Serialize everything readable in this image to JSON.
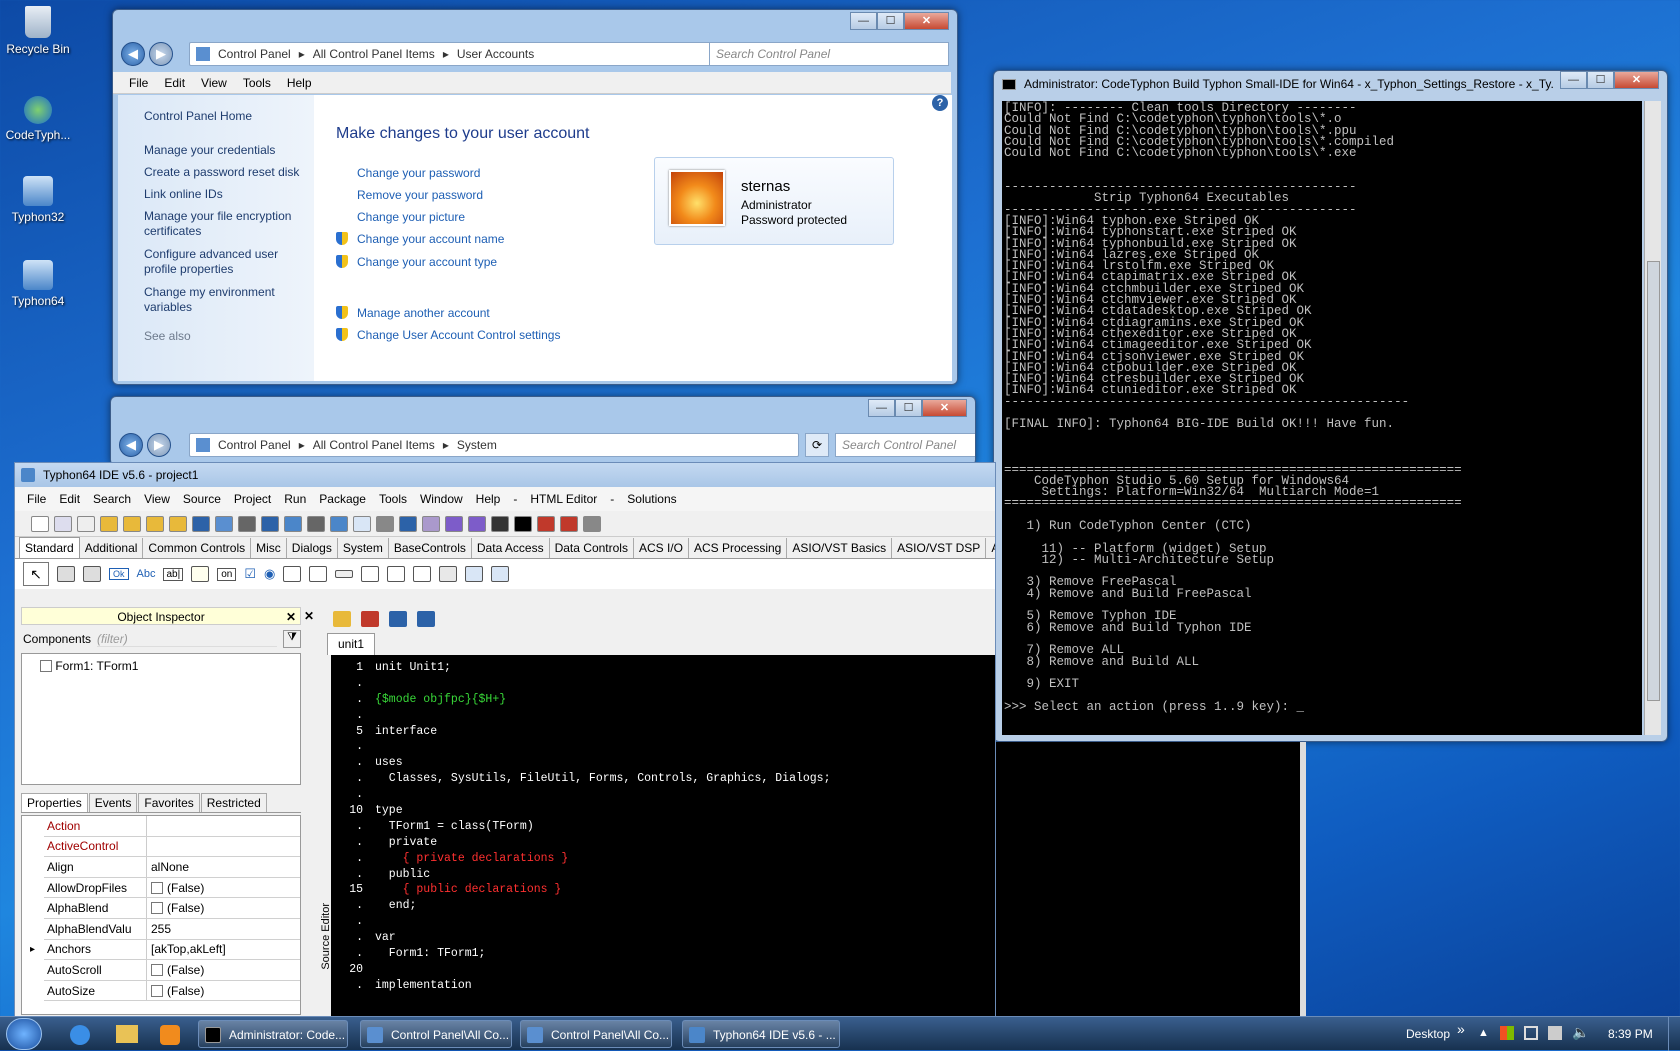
{
  "desktop": {
    "icons": [
      {
        "label": "Recycle Bin",
        "icon": "recycle-bin-icon"
      },
      {
        "label": "CodeTyph...",
        "icon": "codetyphon-icon"
      },
      {
        "label": "Typhon32",
        "icon": "typhon32-icon"
      },
      {
        "label": "Typhon64",
        "icon": "typhon64-icon"
      }
    ]
  },
  "ua_window": {
    "breadcrumb": [
      "Control Panel",
      "All Control Panel Items",
      "User Accounts"
    ],
    "search_placeholder": "Search Control Panel",
    "menu": [
      "File",
      "Edit",
      "View",
      "Tools",
      "Help"
    ],
    "side_home": "Control Panel Home",
    "side_links": [
      "Manage your credentials",
      "Create a password reset disk",
      "Link online IDs",
      "Manage your file encryption certificates",
      "Configure advanced user profile properties",
      "Change my environment variables"
    ],
    "see_also": "See also",
    "heading": "Make changes to your user account",
    "links": [
      "Change your password",
      "Remove your password",
      "Change your picture",
      "Change your account name",
      "Change your account type"
    ],
    "links2": [
      "Manage another account",
      "Change User Account Control settings"
    ],
    "user": {
      "name": "sternas",
      "role": "Administrator",
      "status": "Password protected"
    }
  },
  "sys_window": {
    "breadcrumb": [
      "Control Panel",
      "All Control Panel Items",
      "System"
    ],
    "search_placeholder": "Search Control Panel"
  },
  "console": {
    "title": "Administrator:  CodeTyphon Build Typhon Small-IDE for Win64 - x_Typhon_Settings_Restore - x_Ty...",
    "lines": [
      "[INFO]: -------- Clean tools Directory --------",
      "Could Not Find C:\\codetyphon\\typhon\\tools\\*.o",
      "Could Not Find C:\\codetyphon\\typhon\\tools\\*.ppu",
      "Could Not Find C:\\codetyphon\\typhon\\tools\\*.compiled",
      "Could Not Find C:\\codetyphon\\typhon\\tools\\*.exe",
      "",
      "",
      "-----------------------------------------------",
      "            Strip Typhon64 Executables",
      "-----------------------------------------------",
      "[INFO]:Win64 typhon.exe Striped OK",
      "[INFO]:Win64 typhonstart.exe Striped OK",
      "[INFO]:Win64 typhonbuild.exe Striped OK",
      "[INFO]:Win64 lazres.exe Striped OK",
      "[INFO]:Win64 lrstolfm.exe Striped OK",
      "[INFO]:Win64 ctapimatrix.exe Striped OK",
      "[INFO]:Win64 ctchmbuilder.exe Striped OK",
      "[INFO]:Win64 ctchmviewer.exe Striped OK",
      "[INFO]:Win64 ctdatadesktop.exe Striped OK",
      "[INFO]:Win64 ctdiagramins.exe Striped OK",
      "[INFO]:Win64 cthexeditor.exe Striped OK",
      "[INFO]:Win64 ctimageeditor.exe Striped OK",
      "[INFO]:Win64 ctjsonviewer.exe Striped OK",
      "[INFO]:Win64 ctpobuilder.exe Striped OK",
      "[INFO]:Win64 ctresbuilder.exe Striped OK",
      "[INFO]:Win64 ctunieditor.exe Striped OK",
      "------------------------------------------------------",
      "",
      "[FINAL INFO]: Typhon64 BIG-IDE Build OK!!! Have fun.",
      "",
      "",
      "",
      "=============================================================",
      "    CodeTyphon Studio 5.60 Setup for Windows64",
      "     Settings: Platform=Win32/64  Multiarch Mode=1",
      "=============================================================",
      "",
      "   1) Run CodeTyphon Center (CTC)",
      "",
      "     11) -- Platform (widget) Setup",
      "     12) -- Multi-Architecture Setup",
      "",
      "   3) Remove FreePascal",
      "   4) Remove and Build FreePascal",
      "",
      "   5) Remove Typhon IDE",
      "   6) Remove and Build Typhon IDE",
      "",
      "   7) Remove ALL",
      "   8) Remove and Build ALL",
      "",
      "   9) EXIT",
      "",
      ">>> Select an action (press 1..9 key): _"
    ]
  },
  "ide": {
    "title": "Typhon64 IDE v5.6 - project1",
    "menu": [
      "File",
      "Edit",
      "Search",
      "View",
      "Source",
      "Project",
      "Run",
      "Package",
      "Tools",
      "Window",
      "Help",
      "-",
      "HTML Editor",
      "-",
      "Solutions"
    ],
    "palette_tabs": [
      "Standard",
      "Additional",
      "Common Controls",
      "Misc",
      "Dialogs",
      "System",
      "BaseControls",
      "Data Access",
      "Data Controls",
      "ACS I/O",
      "ACS Processing",
      "ASIO/VST Basics",
      "ASIO/VST DSP",
      "A"
    ],
    "component_glyphs": [
      "Ok",
      "Abc",
      "ab|",
      "on"
    ],
    "object_inspector": {
      "title": "Object Inspector",
      "components_label": "Components",
      "filter_placeholder": "(filter)",
      "tree_item": "Form1: TForm1",
      "tabs": [
        "Properties",
        "Events",
        "Favorites",
        "Restricted"
      ],
      "props": [
        {
          "name": "Action",
          "value": "",
          "red": true,
          "checkbox": false,
          "expand": false
        },
        {
          "name": "ActiveControl",
          "value": "",
          "red": true,
          "checkbox": false,
          "expand": false
        },
        {
          "name": "Align",
          "value": "alNone",
          "red": false,
          "checkbox": false,
          "expand": false
        },
        {
          "name": "AllowDropFiles",
          "value": "(False)",
          "red": false,
          "checkbox": true,
          "expand": false
        },
        {
          "name": "AlphaBlend",
          "value": "(False)",
          "red": false,
          "checkbox": true,
          "expand": false
        },
        {
          "name": "AlphaBlendValu",
          "value": "255",
          "red": false,
          "checkbox": false,
          "expand": false
        },
        {
          "name": "Anchors",
          "value": "[akTop,akLeft]",
          "red": false,
          "checkbox": false,
          "expand": true
        },
        {
          "name": "AutoScroll",
          "value": "(False)",
          "red": false,
          "checkbox": true,
          "expand": false
        },
        {
          "name": "AutoSize",
          "value": "(False)",
          "red": false,
          "checkbox": true,
          "expand": false
        }
      ]
    },
    "editor": {
      "tab": "unit1",
      "side_label": "Source Editor",
      "lines": [
        {
          "n": "1",
          "t": "unit Unit1;",
          "c": "#ffffff"
        },
        {
          "n": ".",
          "t": "",
          "c": "#ffffff"
        },
        {
          "n": ".",
          "t": "{$mode objfpc}{$H+}",
          "c": "#38d838"
        },
        {
          "n": ".",
          "t": "",
          "c": "#ffffff"
        },
        {
          "n": "5",
          "t": "interface",
          "c": "#ffffff"
        },
        {
          "n": ".",
          "t": "",
          "c": "#ffffff"
        },
        {
          "n": ".",
          "t": "uses",
          "c": "#ffffff"
        },
        {
          "n": ".",
          "t": "  Classes, SysUtils, FileUtil, Forms, Controls, Graphics, Dialogs;",
          "c": "#ffffff"
        },
        {
          "n": ".",
          "t": "",
          "c": "#ffffff"
        },
        {
          "n": "10",
          "t": "type",
          "c": "#ffffff"
        },
        {
          "n": ".",
          "t": "  TForm1 = class(TForm)",
          "c": "#ffffff"
        },
        {
          "n": ".",
          "t": "  private",
          "c": "#ffffff"
        },
        {
          "n": ".",
          "t": "    { private declarations }",
          "c": "#ff3030"
        },
        {
          "n": ".",
          "t": "  public",
          "c": "#ffffff"
        },
        {
          "n": "15",
          "t": "    { public declarations }",
          "c": "#ff3030"
        },
        {
          "n": ".",
          "t": "  end;",
          "c": "#ffffff"
        },
        {
          "n": ".",
          "t": "",
          "c": "#ffffff"
        },
        {
          "n": ".",
          "t": "var",
          "c": "#ffffff"
        },
        {
          "n": ".",
          "t": "  Form1: TForm1;",
          "c": "#ffffff"
        },
        {
          "n": "20",
          "t": "",
          "c": "#ffffff"
        },
        {
          "n": ".",
          "t": "implementation",
          "c": "#ffffff"
        }
      ]
    }
  },
  "taskbar": {
    "tasks": [
      "Administrator: Code...",
      "Control Panel\\All Co...",
      "Control Panel\\All Co...",
      "Typhon64 IDE v5.6 - ..."
    ],
    "desktop_label": "Desktop",
    "toolbar_chevron": "»",
    "clock": "8:39 PM"
  },
  "colors": {
    "accent": "#1e5fb4",
    "console_bg": "#000000",
    "console_fg": "#c0c0c0",
    "ide_palette_active": "#ffffff",
    "oi_header": "#ffffd8"
  }
}
